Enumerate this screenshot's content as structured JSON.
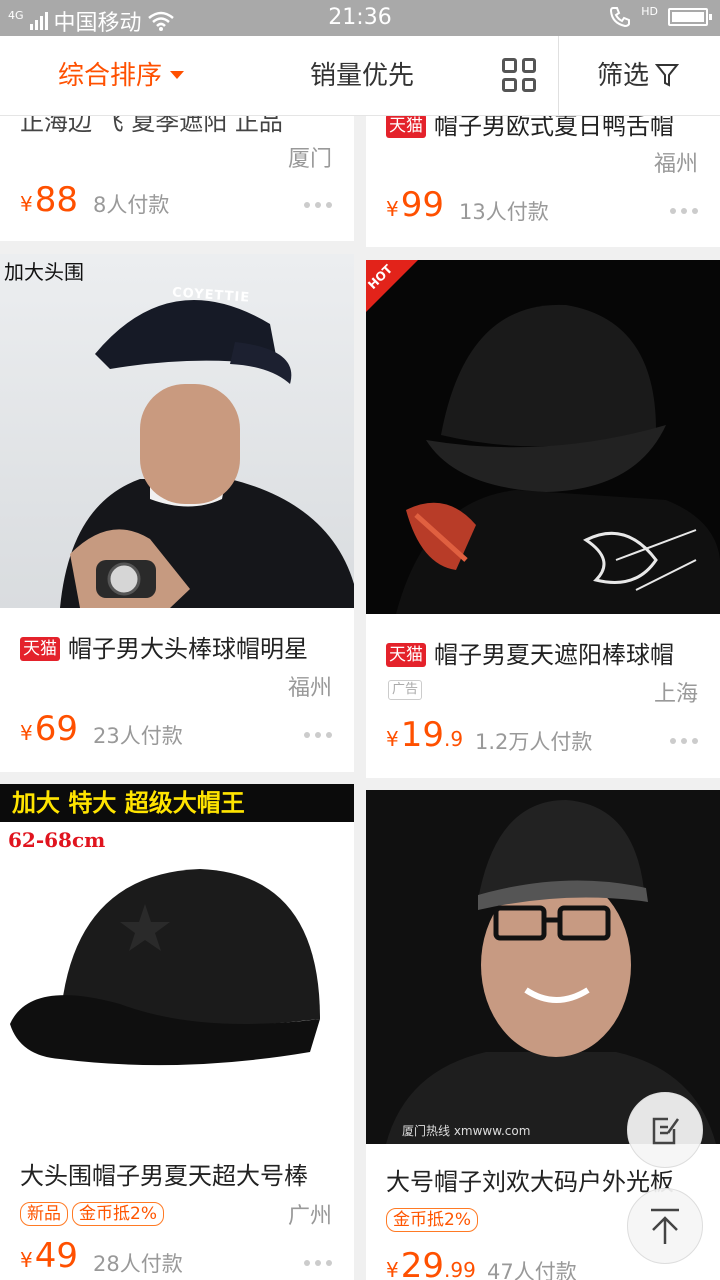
{
  "status_bar": {
    "network": "4G",
    "carrier": "中国移动",
    "time": "21:36",
    "hd": "HD"
  },
  "sort_bar": {
    "comprehensive": "综合排序",
    "sales": "销量优先",
    "filter": "筛选"
  },
  "colors": {
    "accent": "#ff5000",
    "tmall_red": "#e4222b"
  },
  "products": [
    {
      "title_partial": "正海边 飞 夏季遮阳 正品",
      "location": "厦门",
      "price": "88",
      "sold": "8人付款"
    },
    {
      "tmall_badge": "天猫",
      "title_partial": "帽子男欧式夏日鸭舌帽",
      "location": "福州",
      "price": "99",
      "sold": "13人付款"
    },
    {
      "image_caption": "加大头围",
      "image_text": "COYETTIE",
      "tmall_badge": "天猫",
      "title": "帽子男大头棒球帽明星",
      "location": "福州",
      "price": "69",
      "sold": "23人付款"
    },
    {
      "image_badge": "HOT",
      "tmall_badge": "天猫",
      "title": "帽子男夏天遮阳棒球帽",
      "ad": "广告",
      "location": "上海",
      "price": "19",
      "price_decimal": ".9",
      "sold": "1.2万人付款"
    },
    {
      "image_banner": "加大 特大 超级大帽王",
      "image_size": "62-68cm",
      "title": "大头围帽子男夏天超大号棒",
      "tags": [
        "新品",
        "金币抵2%"
      ],
      "location": "广州",
      "price": "49",
      "sold": "28人付款"
    },
    {
      "image_watermark": "厦门热线 xmwww.com",
      "title": "大号帽子刘欢大码户外光板",
      "tags": [
        "金币抵2%"
      ],
      "price": "29",
      "price_decimal": ".99",
      "sold": "47人付款"
    }
  ],
  "currency": "¥"
}
